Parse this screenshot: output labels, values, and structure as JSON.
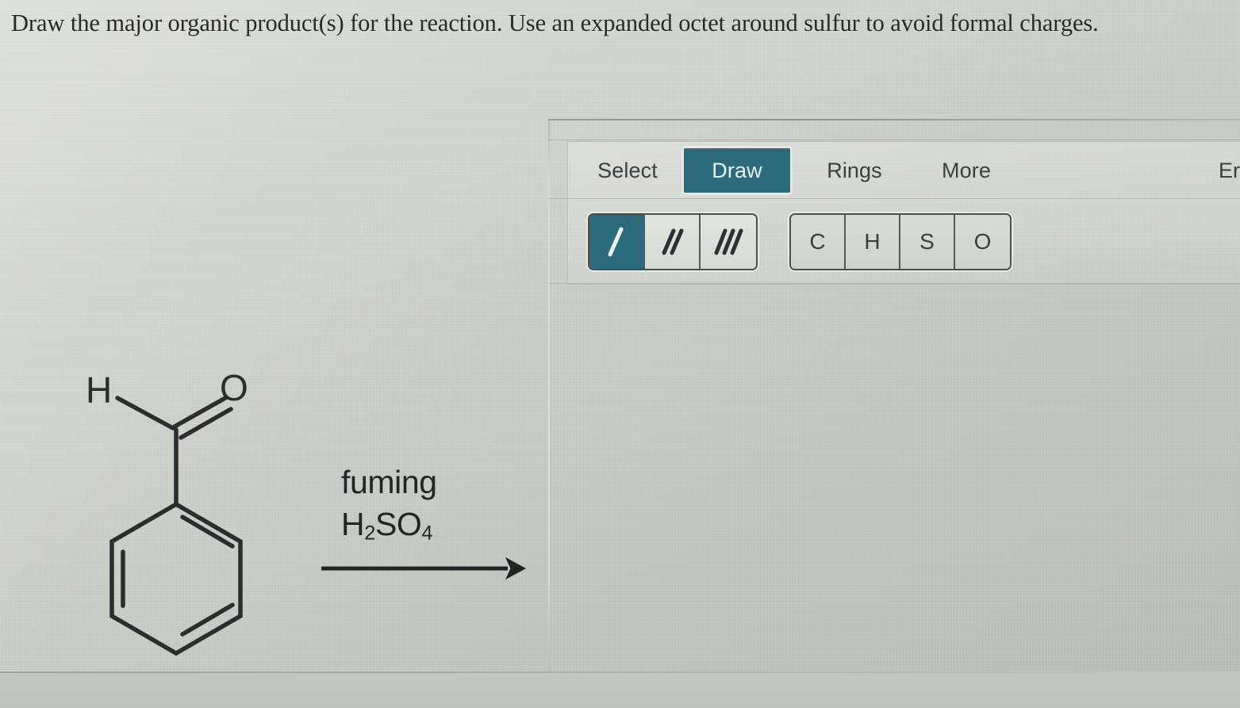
{
  "prompt": {
    "text": "Draw the major organic product(s) for the reaction. Use an expanded octet around sulfur to avoid formal charges."
  },
  "reaction": {
    "reactant_name": "benzaldehyde",
    "atom_labels": {
      "aldehyde_h": "H",
      "carbonyl_o": "O"
    },
    "reagent_line1": "fuming",
    "reagent_line2_formula": "H",
    "reagent_line2_sub1": "2",
    "reagent_line2_mid": "SO",
    "reagent_line2_sub2": "4",
    "arrow": "reaction-arrow-right"
  },
  "editor": {
    "tabs": [
      {
        "label": "Select",
        "active": false
      },
      {
        "label": "Draw",
        "active": true
      },
      {
        "label": "Rings",
        "active": false
      },
      {
        "label": "More",
        "active": false
      },
      {
        "label": "Er",
        "active": false
      }
    ],
    "bond_tools": [
      {
        "name": "single-bond",
        "label": "/",
        "selected": true
      },
      {
        "name": "double-bond",
        "label": "//",
        "selected": false
      },
      {
        "name": "triple-bond",
        "label": "///",
        "selected": false
      }
    ],
    "element_tools": [
      {
        "label": "C"
      },
      {
        "label": "H"
      },
      {
        "label": "S"
      },
      {
        "label": "O"
      }
    ]
  },
  "colors": {
    "accent_teal": "#2b6b7c",
    "accent_teal_text": "#eaf4f6",
    "background": "#c9ccc6",
    "ink": "#2b2d2e",
    "button_border": "#4a4d4e"
  }
}
